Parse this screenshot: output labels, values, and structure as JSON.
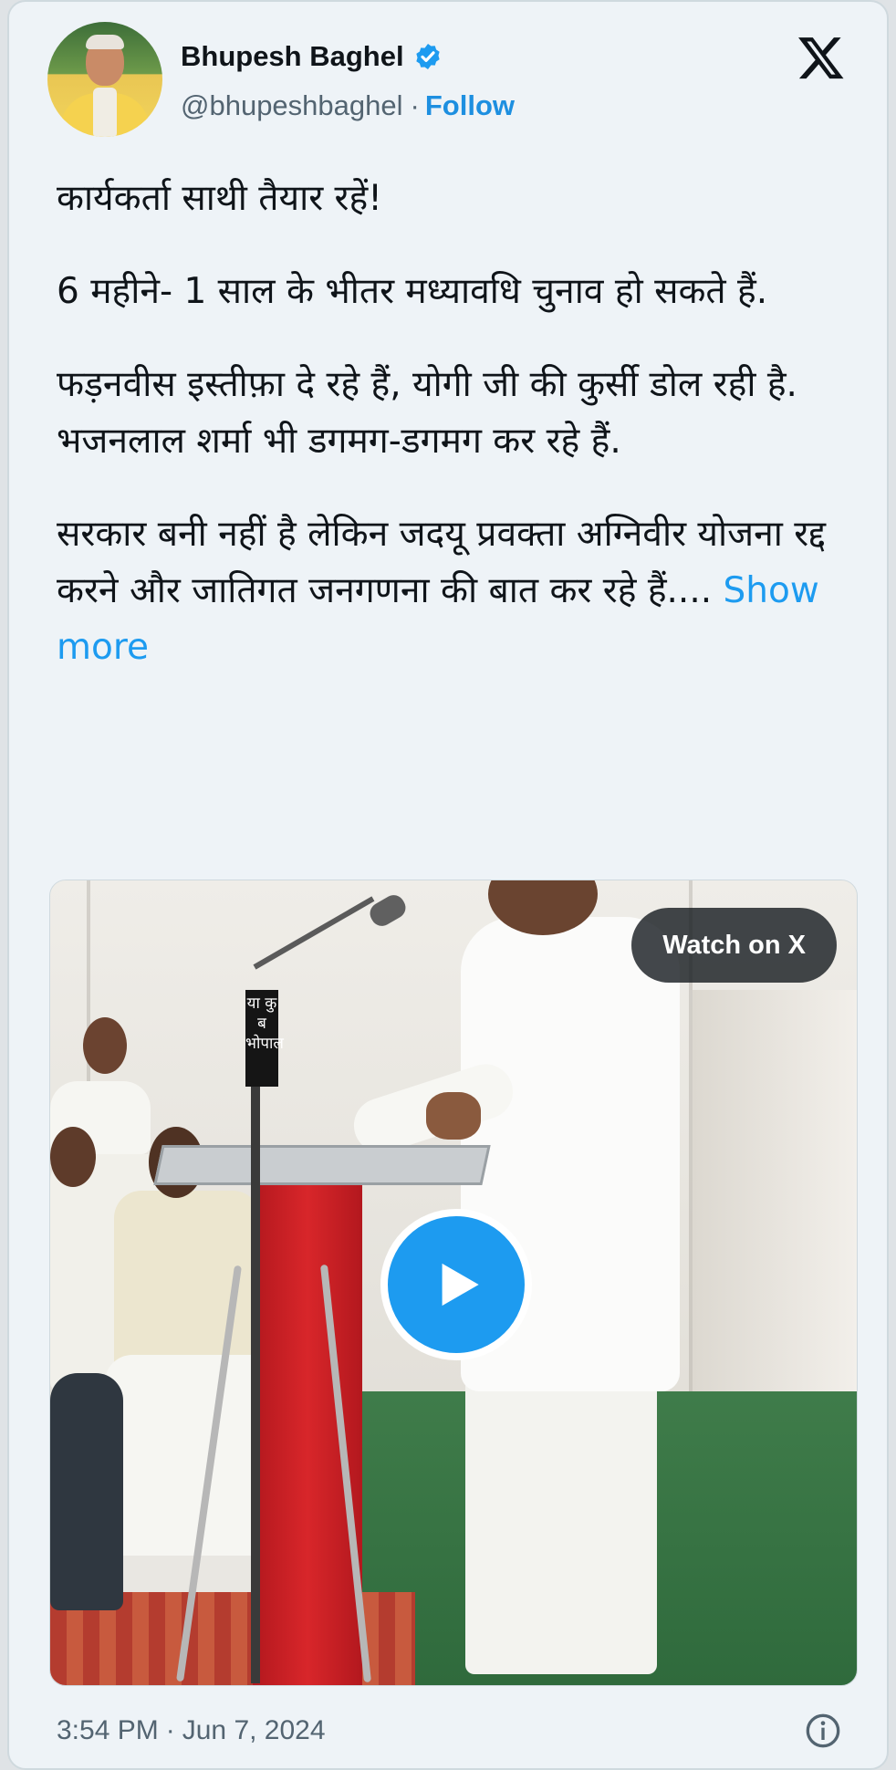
{
  "author": {
    "name": "Bhupesh Baghel",
    "handle": "@bhupeshbaghel",
    "separator": "·",
    "follow_label": "Follow",
    "verified_icon": "verified-badge-icon"
  },
  "tweet": {
    "paragraphs": [
      "कार्यकर्ता साथी तैयार रहें!",
      "6 महीने- 1 साल के भीतर मध्यावधि चुनाव हो सकते हैं.",
      "फड़नवीस इस्तीफ़ा दे रहे हैं, योगी जी की कुर्सी डोल रही है. भजनलाल शर्मा भी डगमग-डगमग कर रहे हैं."
    ],
    "last_paragraph": "सरकार बनी नहीं है लेकिन जदयू प्रवक्ता अग्निवीर योजना रद्द करने और जातिगत जनगणना की बात कर रहे हैं....",
    "show_more_label": "Show more"
  },
  "media": {
    "watch_label": "Watch on X",
    "mic_flag_text": "या कु ब भोपाल"
  },
  "footer": {
    "time": "3:54 PM",
    "separator": "·",
    "date": "Jun 7, 2024"
  },
  "colors": {
    "accent": "#1d9bf0",
    "text": "#0f1419",
    "muted": "#536471",
    "background": "#eef3f7"
  }
}
